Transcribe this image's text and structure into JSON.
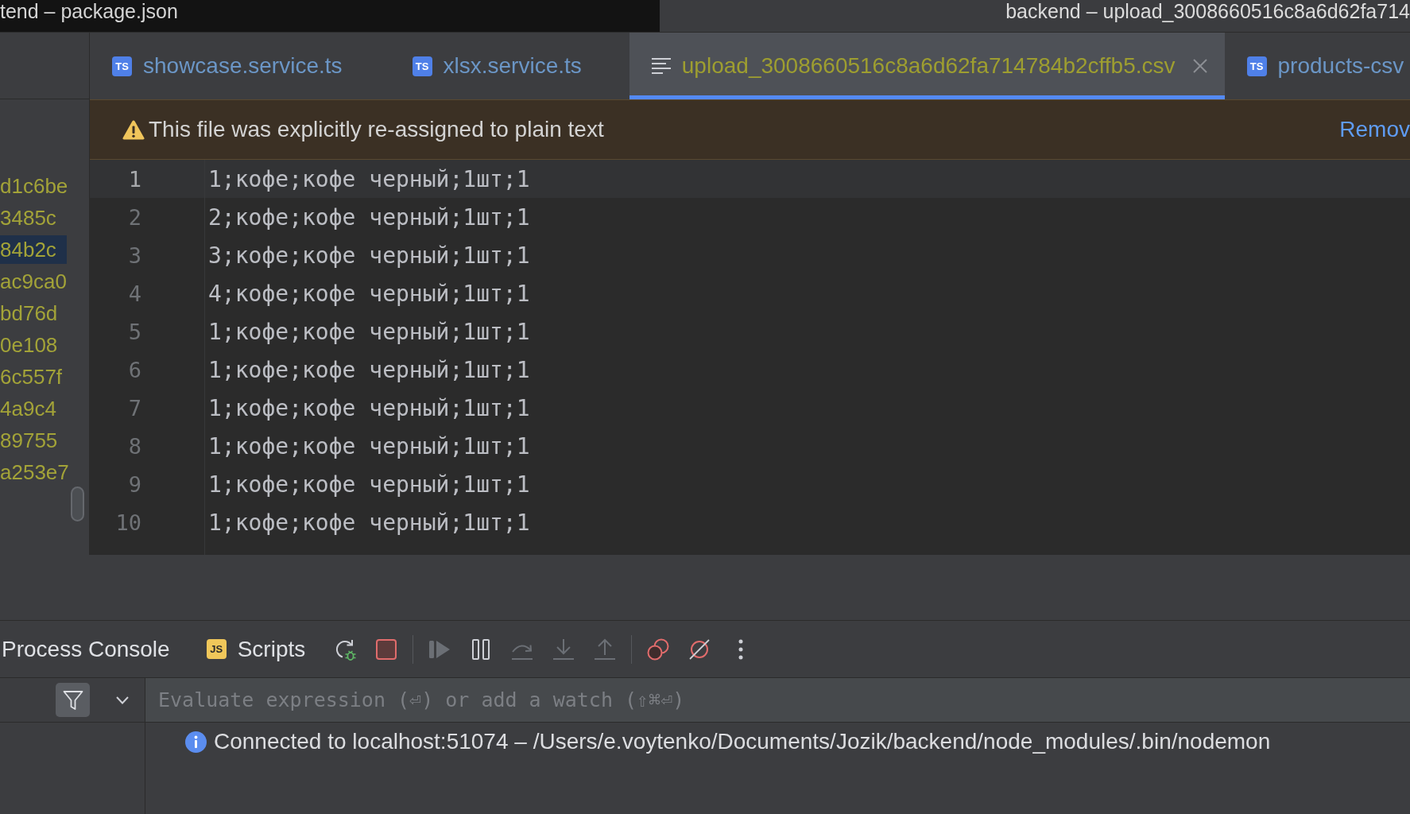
{
  "title_bar": {
    "left_title": "tend – package.json",
    "right_title": "backend – upload_3008660516c8a6d62fa714"
  },
  "project_tree": {
    "items": [
      {
        "label": "d1c6be",
        "selected": false
      },
      {
        "label": "3485c",
        "selected": false
      },
      {
        "label": "84b2c",
        "selected": true
      },
      {
        "label": "ac9ca0",
        "selected": false
      },
      {
        "label": "bd76d",
        "selected": false
      },
      {
        "label": "0e108",
        "selected": false
      },
      {
        "label": "6c557f",
        "selected": false
      },
      {
        "label": "4a9c4",
        "selected": false
      },
      {
        "label": "89755",
        "selected": false
      },
      {
        "label": "a253e7",
        "selected": false
      }
    ]
  },
  "tabs": [
    {
      "kind": "typescript",
      "badge": "TS",
      "label": "showcase.service.ts",
      "color": "#6b96c6",
      "selected": false
    },
    {
      "kind": "typescript",
      "badge": "TS",
      "label": "xlsx.service.ts",
      "color": "#6b96c6",
      "selected": false
    },
    {
      "kind": "text",
      "label": "upload_3008660516c8a6d62fa714784b2cffb5.csv",
      "color": "#9e9e30",
      "selected": true
    },
    {
      "kind": "typescript",
      "badge": "TS",
      "label": "products-csv",
      "color": "#6b96c6",
      "selected": false
    }
  ],
  "banner": {
    "message": "This file was explicitly re-assigned to plain text",
    "action": "Remov"
  },
  "editor": {
    "lines": [
      {
        "number": "1",
        "text": "1;кофе;кофе черный;1шт;1",
        "current": true
      },
      {
        "number": "2",
        "text": "2;кофе;кофе черный;1шт;1",
        "current": false
      },
      {
        "number": "3",
        "text": "3;кофе;кофе черный;1шт;1",
        "current": false
      },
      {
        "number": "4",
        "text": "4;кофе;кофе черный;1шт;1",
        "current": false
      },
      {
        "number": "5",
        "text": "1;кофе;кофе черный;1шт;1",
        "current": false
      },
      {
        "number": "6",
        "text": "1;кофе;кофе черный;1шт;1",
        "current": false
      },
      {
        "number": "7",
        "text": "1;кофе;кофе черный;1шт;1",
        "current": false
      },
      {
        "number": "8",
        "text": "1;кофе;кофе черный;1шт;1",
        "current": false
      },
      {
        "number": "9",
        "text": "1;кофе;кофе черный;1шт;1",
        "current": false
      },
      {
        "number": "10",
        "text": "1;кофе;кофе черный;1шт;1",
        "current": false
      }
    ]
  },
  "debug_toolbar": {
    "tabs": [
      {
        "kind": "console",
        "label": "Process Console"
      },
      {
        "kind": "script",
        "badge": "JS",
        "label": "Scripts"
      }
    ],
    "groups": [
      {
        "actions": [
          {
            "kind": "rerun",
            "disabled": false
          },
          {
            "kind": "stop",
            "disabled": false
          }
        ]
      },
      {
        "actions": [
          {
            "kind": "resume",
            "disabled": true
          },
          {
            "kind": "pause",
            "disabled": false
          },
          {
            "kind": "step_over",
            "disabled": true
          },
          {
            "kind": "step_into",
            "disabled": true
          },
          {
            "kind": "step_out",
            "disabled": true
          }
        ]
      },
      {
        "actions": [
          {
            "kind": "breakpoints",
            "disabled": false
          },
          {
            "kind": "mute",
            "disabled": false
          },
          {
            "kind": "more",
            "disabled": false
          }
        ]
      }
    ]
  },
  "console": {
    "placeholder": "Evaluate expression (⏎) or add a watch (⇧⌘⏎)",
    "messages": [
      {
        "kind": "info",
        "text": "Connected to localhost:51074 – /Users/e.voytenko/Documents/Jozik/backend/node_modules/.bin/nodemon"
      }
    ]
  }
}
